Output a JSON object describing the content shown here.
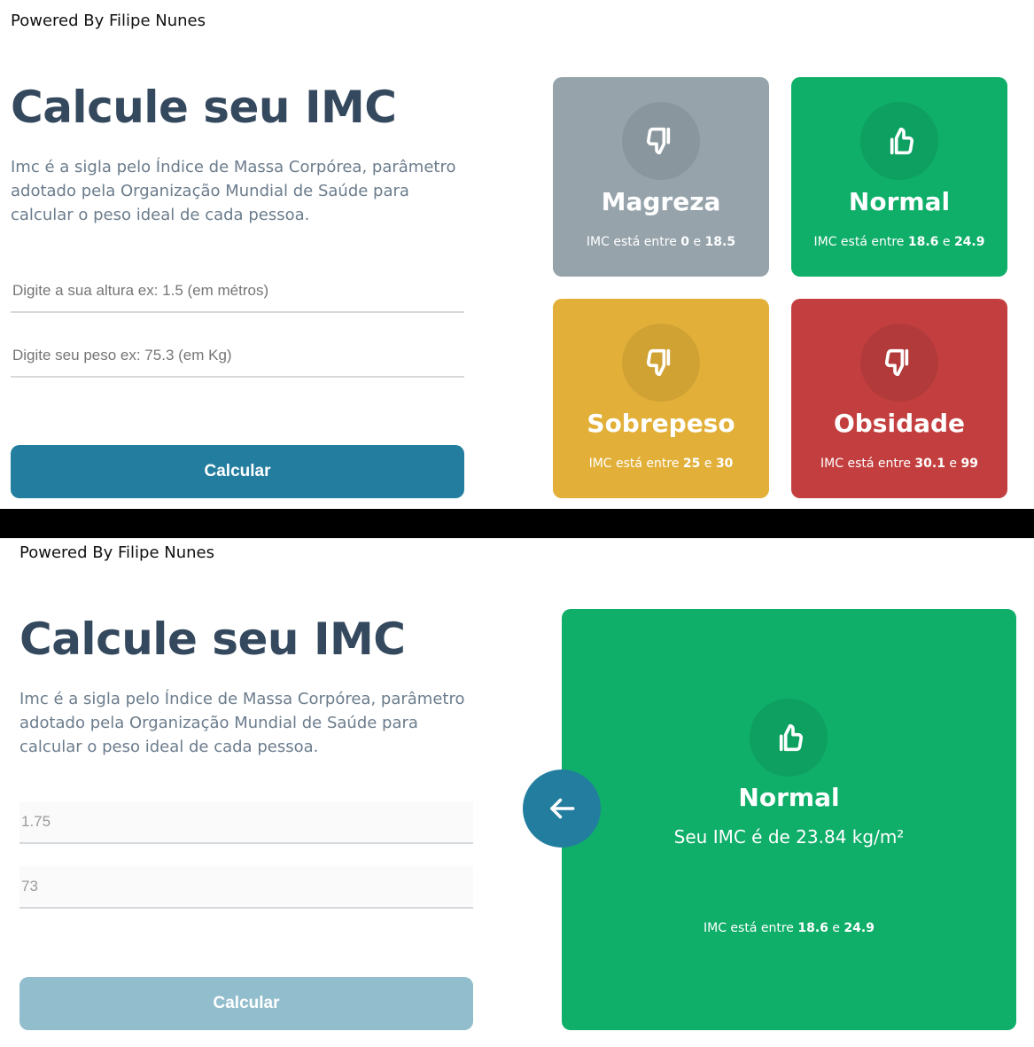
{
  "powered_by": "Powered By Filipe Nunes",
  "title": "Calcule seu IMC",
  "description": "Imc é a sigla pelo Índice de Massa Corpórea, parâmetro adotado pela Organização Mundial de Saúde para calcular o peso ideal de cada pessoa.",
  "form": {
    "height_placeholder": "Digite a sua altura ex: 1.5 (em métros)",
    "weight_placeholder": "Digite seu peso ex: 75.3 (em Kg)",
    "button_label": "Calcular",
    "height_value": "1.75",
    "weight_value": "73"
  },
  "range_prefix": "IMC está entre",
  "range_and": "e",
  "cards": [
    {
      "name": "Magreza",
      "min": "0",
      "max": "18.5",
      "color": "#96a3ab",
      "icon": "thumbs-down-icon"
    },
    {
      "name": "Normal",
      "min": "18.6",
      "max": "24.9",
      "color": "#0fae69",
      "icon": "thumbs-up-icon"
    },
    {
      "name": "Sobrepeso",
      "min": "25",
      "max": "30",
      "color": "#e2b039",
      "icon": "thumbs-down-icon"
    },
    {
      "name": "Obsidade",
      "min": "30.1",
      "max": "99",
      "color": "#c33f3f",
      "icon": "thumbs-down-icon"
    }
  ],
  "result": {
    "name": "Normal",
    "imc_text": "Seu IMC é de 23.84 kg/m²",
    "min": "18.6",
    "max": "24.9",
    "color": "#0fae69",
    "icon": "thumbs-up-icon",
    "back_icon": "arrow-left-icon"
  }
}
